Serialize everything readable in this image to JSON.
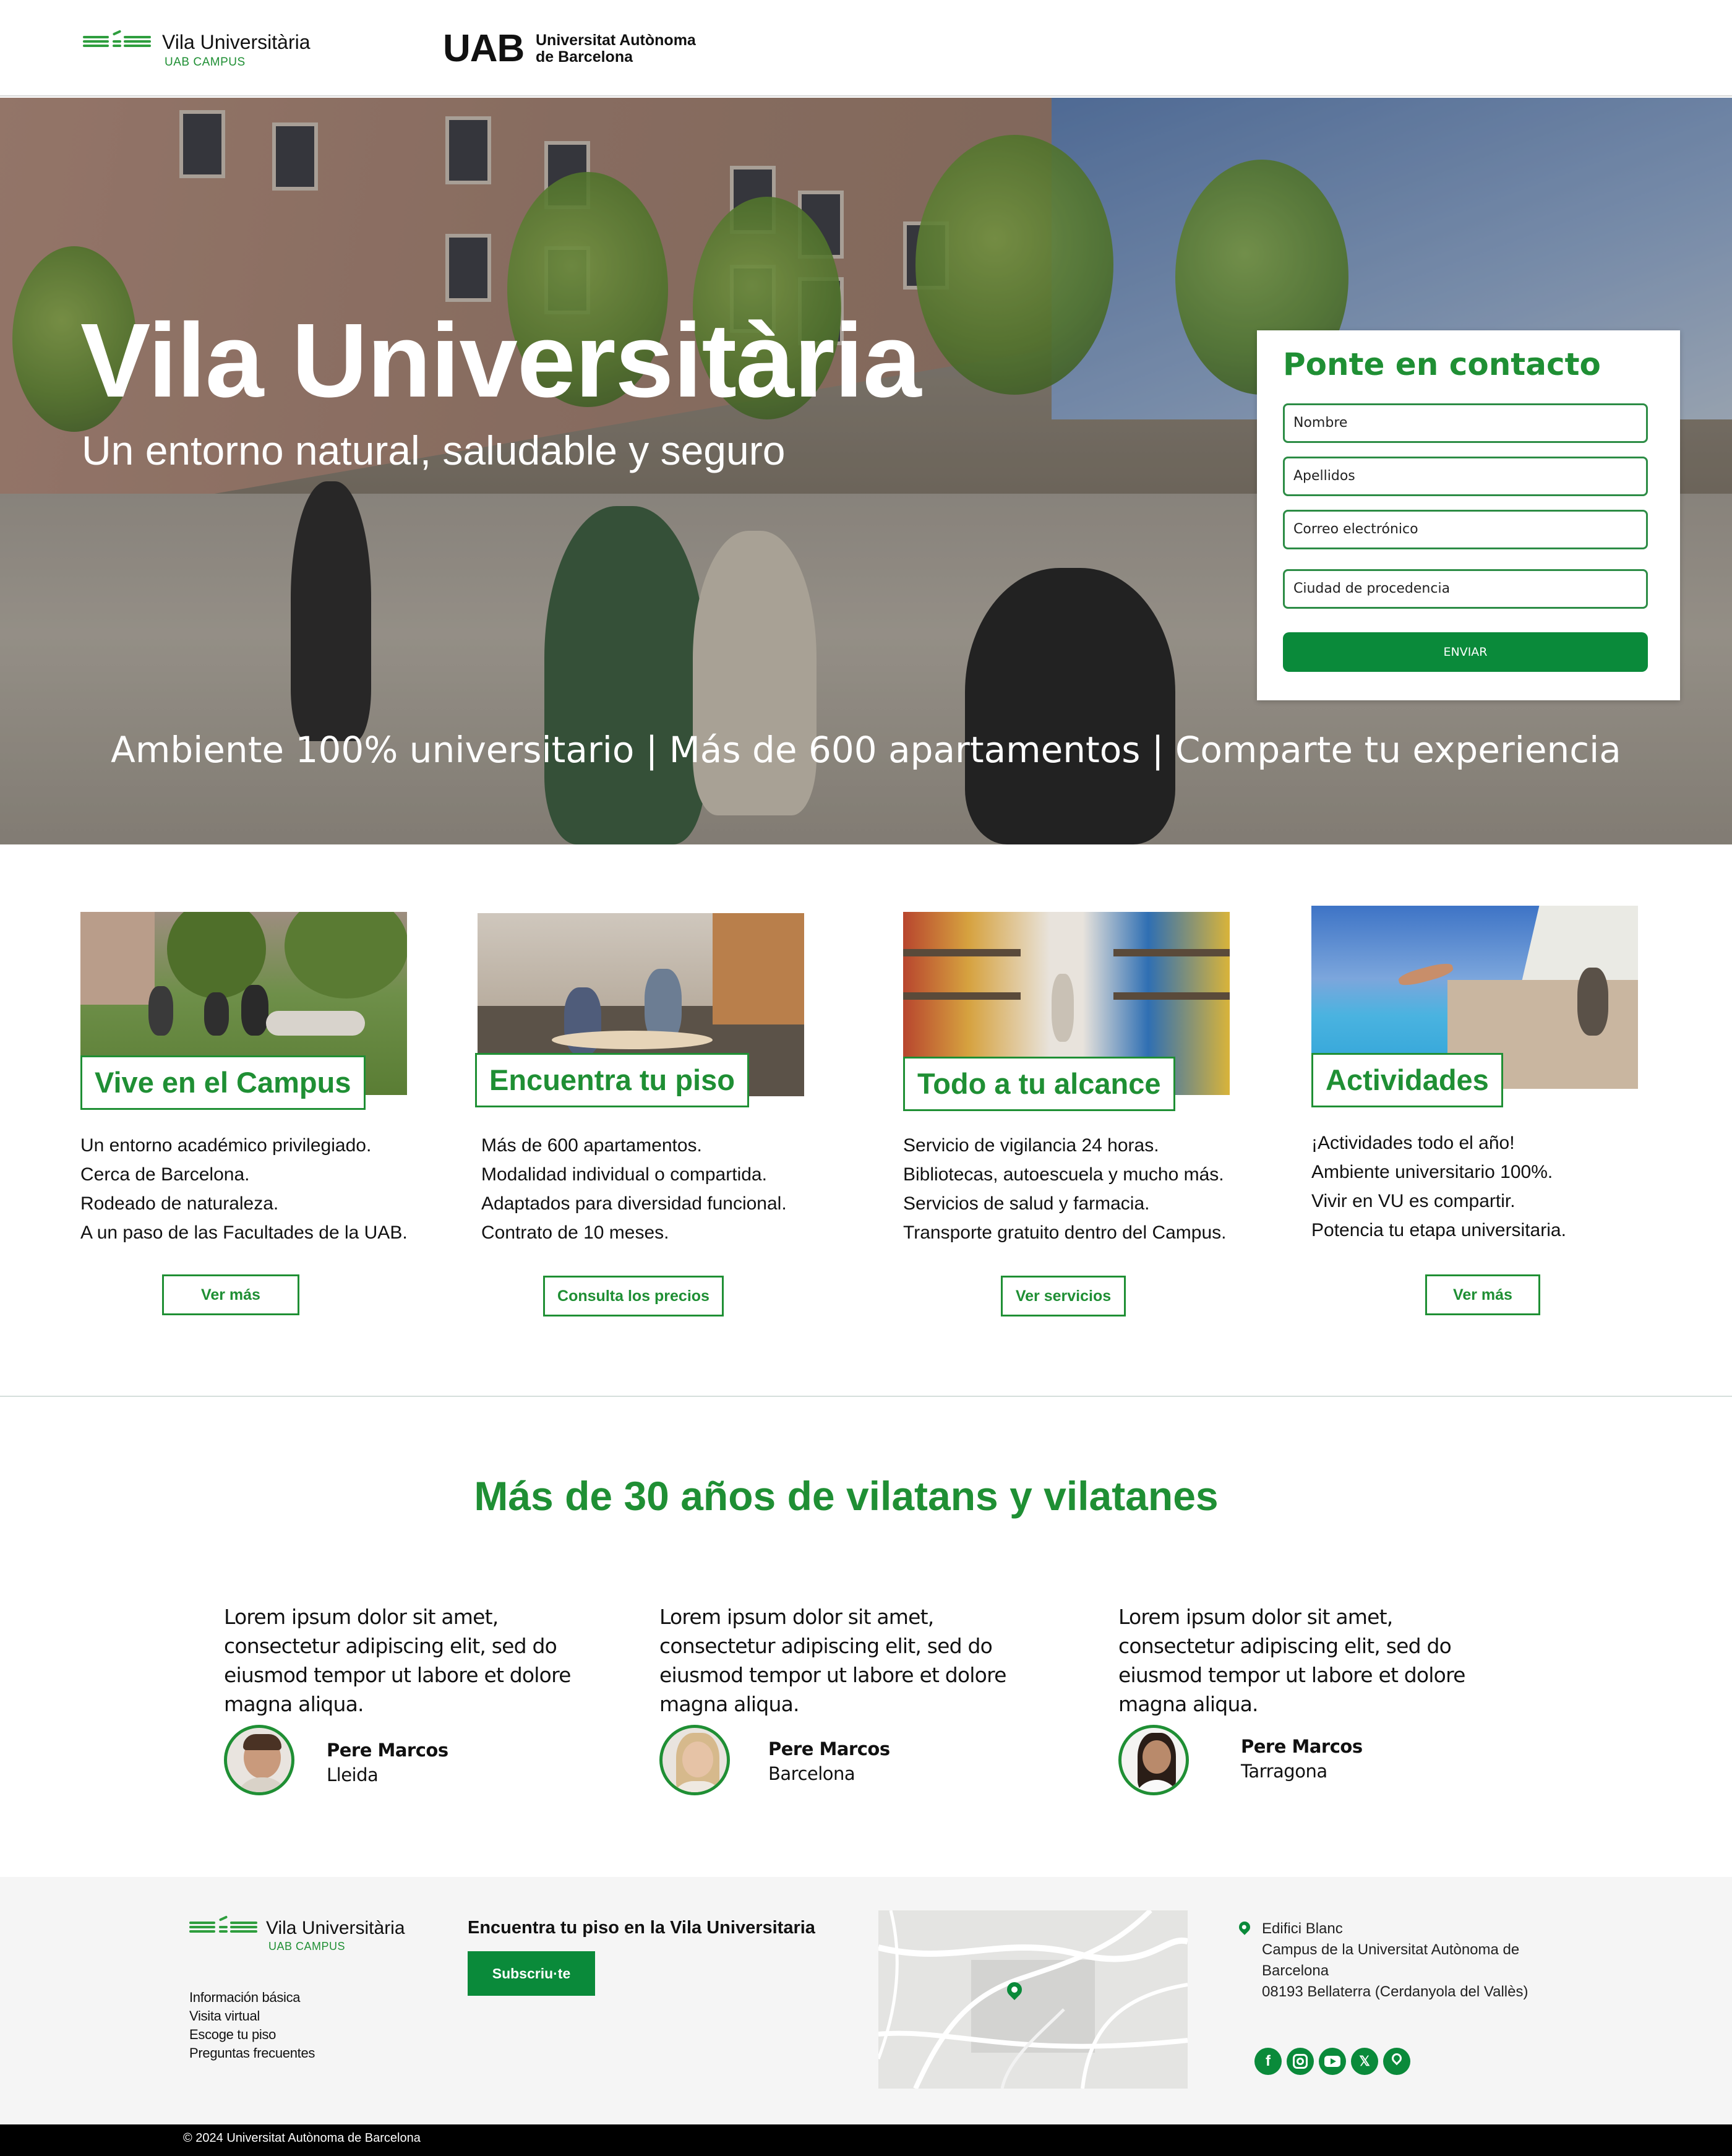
{
  "brand": {
    "name": "Vila Universitària",
    "campus": "UAB CAMPUS",
    "uab_mark": "UAB",
    "uab_name_line1": "Universitat Autònoma",
    "uab_name_line2": "de Barcelona",
    "accent_color": "#1f8f34",
    "button_color": "#0a8a3a"
  },
  "hero": {
    "title": "Vila Universitària",
    "subtitle": "Un entorno natural, saludable y seguro",
    "tagline": "Ambiente 100% universitario | Más de 600 apartamentos | Comparte tu experiencia"
  },
  "contact": {
    "title": "Ponte en contacto",
    "fields": [
      {
        "placeholder": "Nombre"
      },
      {
        "placeholder": "Apellidos"
      },
      {
        "placeholder": "Correo electrónico"
      },
      {
        "placeholder": "Ciudad de procedencia"
      }
    ],
    "submit_label": "ENVIAR"
  },
  "features": [
    {
      "title": "Vive en el Campus",
      "lines": [
        "Un entorno académico privilegiado.",
        "Cerca de Barcelona.",
        "Rodeado de naturaleza.",
        "A un paso de las Facultades de la UAB."
      ],
      "button": "Ver más"
    },
    {
      "title": "Encuentra tu piso",
      "lines": [
        "Más de 600 apartamentos.",
        "Modalidad individual o compartida.",
        "Adaptados para diversidad funcional.",
        "Contrato de 10 meses."
      ],
      "button": "Consulta los precios"
    },
    {
      "title": "Todo a tu alcance",
      "lines": [
        "Servicio de vigilancia 24 horas.",
        "Bibliotecas, autoescuela y mucho más.",
        "Servicios de salud y farmacia.",
        "Transporte gratuito dentro del Campus."
      ],
      "button": "Ver servicios"
    },
    {
      "title": "Actividades",
      "lines": [
        "¡Actividades todo el año!",
        "Ambiente universitario 100%.",
        "Vivir en VU es compartir.",
        "Potencia tu etapa universitaria."
      ],
      "button": "Ver más"
    }
  ],
  "testimonials": {
    "heading": "Más de 30 años de vilatans y vilatanes",
    "items": [
      {
        "quote": "Lorem ipsum dolor sit amet, consectetur adipiscing elit, sed do eiusmod tempor ut labore et dolore magna aliqua.",
        "name": "Pere Marcos",
        "city": "Lleida"
      },
      {
        "quote": "Lorem ipsum dolor sit amet, consectetur adipiscing elit, sed do eiusmod tempor ut labore et dolore magna aliqua.",
        "name": "Pere Marcos",
        "city": "Barcelona"
      },
      {
        "quote": "Lorem ipsum dolor sit amet, consectetur adipiscing elit, sed do eiusmod tempor ut labore et dolore magna aliqua.",
        "name": "Pere Marcos",
        "city": "Tarragona"
      }
    ]
  },
  "footer": {
    "links": [
      "Información básica",
      "Visita virtual",
      "Escoge tu piso",
      "Preguntas frecuentes"
    ],
    "subscribe_title": "Encuentra tu piso en la Vila Universitaria",
    "subscribe_button": "Subscriu·te",
    "address": [
      "Edifici Blanc",
      "Campus de la Universitat Autònoma de",
      "Barcelona",
      "08193 Bellaterra (Cerdanyola del Vallès)"
    ],
    "social_icons": [
      "facebook-icon",
      "instagram-icon",
      "youtube-icon",
      "x-icon",
      "location-icon"
    ],
    "copyright": "© 2024 Universitat Autònoma de Barcelona"
  }
}
